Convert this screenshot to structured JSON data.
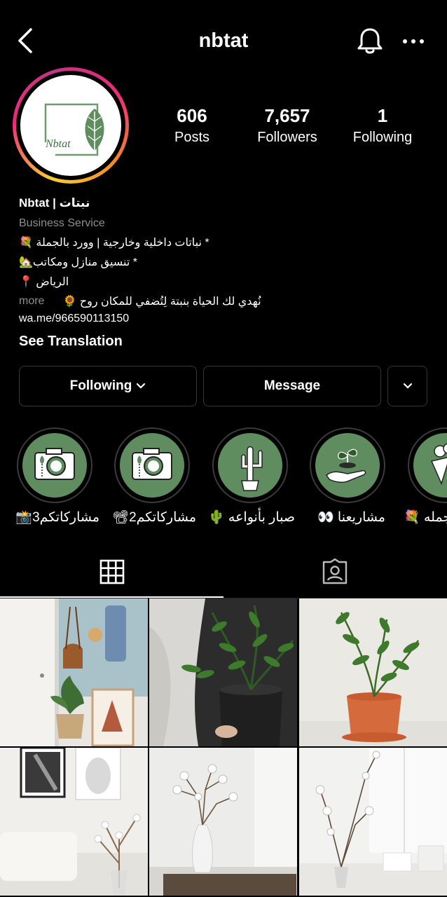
{
  "header": {
    "title": "nbtat"
  },
  "profile": {
    "logo_text": "Nbtat",
    "stats": [
      {
        "value": "606",
        "label": "Posts"
      },
      {
        "value": "7,657",
        "label": "Followers"
      },
      {
        "value": "1",
        "label": "Following"
      }
    ],
    "name": "Nbtat | نبتات",
    "category": "Business Service",
    "bio_lines": [
      "* نباتات داخلية وخارجية | وورد بالجملة 💐",
      "* تنسيق منازل ومكاتب🏡",
      "الرياض 📍"
    ],
    "bio_last_line": "نُهدي لك الحياة بنبتة لِتُضفي للمكان روح 🌻",
    "more_label": "more",
    "link": "wa.me/966590113150",
    "see_translation": "See Translation"
  },
  "actions": {
    "following_label": "Following",
    "message_label": "Message"
  },
  "highlights": [
    {
      "label": "مشاركاتكم3📸",
      "icon": "camera-icon"
    },
    {
      "label": "مشاركاتكم2📽",
      "icon": "camera-icon"
    },
    {
      "label": "صبار بأنواعه 🌵",
      "icon": "cactus-icon"
    },
    {
      "label": "مشاريعنا 👀",
      "icon": "hand-plant-icon"
    },
    {
      "label": "💐 جمله",
      "icon": "bouquet-icon"
    }
  ],
  "colors": {
    "accent_green": "#5f8d5f",
    "border": "#363636",
    "secondary_text": "#8e8e8e"
  }
}
